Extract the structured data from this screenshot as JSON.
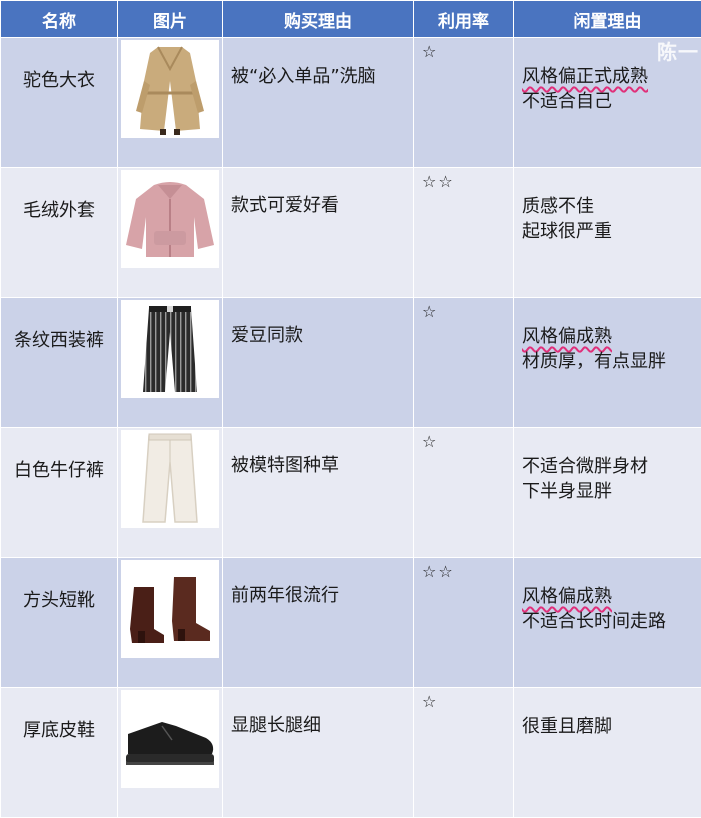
{
  "headers": [
    "名称",
    "图片",
    "购买理由",
    "利用率",
    "闲置理由"
  ],
  "rows": [
    {
      "name": "驼色大衣",
      "image_icon": "camel-coat-icon",
      "reason": "被“必入单品”洗脑",
      "rating": "☆",
      "idle_lines": [
        {
          "text": "风格偏正式成熟",
          "highlight": true
        },
        {
          "text": "不适合自己",
          "highlight": false
        }
      ]
    },
    {
      "name": "毛绒外套",
      "image_icon": "pink-fleece-jacket-icon",
      "reason": "款式可爱好看",
      "rating": "☆☆",
      "idle_lines": [
        {
          "text": "质感不佳",
          "highlight": false
        },
        {
          "text": "起球很严重",
          "highlight": false
        }
      ]
    },
    {
      "name": "条纹西装裤",
      "image_icon": "striped-trousers-icon",
      "reason": "爱豆同款",
      "rating": "☆",
      "idle_lines": [
        {
          "text": "风格偏成熟",
          "highlight": true
        },
        {
          "text": "材质厚，有点显胖",
          "highlight": false
        }
      ]
    },
    {
      "name": "白色牛仔裤",
      "image_icon": "white-jeans-icon",
      "reason": "被模特图种草",
      "rating": "☆",
      "idle_lines": [
        {
          "text": "不适合微胖身材",
          "highlight": false
        },
        {
          "text": "下半身显胖",
          "highlight": false
        }
      ]
    },
    {
      "name": "方头短靴",
      "image_icon": "square-toe-boots-icon",
      "reason": "前两年很流行",
      "rating": "☆☆",
      "idle_lines": [
        {
          "text": "风格偏成熟",
          "highlight": true
        },
        {
          "text": "不适合长时间走路",
          "highlight": false
        }
      ]
    },
    {
      "name": "厚底皮鞋",
      "image_icon": "platform-leather-shoe-icon",
      "reason": "显腿长腿细",
      "rating": "☆",
      "idle_lines": [
        {
          "text": "很重且磨脚",
          "highlight": false
        }
      ]
    }
  ],
  "watermark": "陈一",
  "colors": {
    "header": "#4a74c0",
    "row_odd": "#cbd2e8",
    "row_even": "#e8eaf3",
    "highlight_underline": "#e0307a"
  }
}
